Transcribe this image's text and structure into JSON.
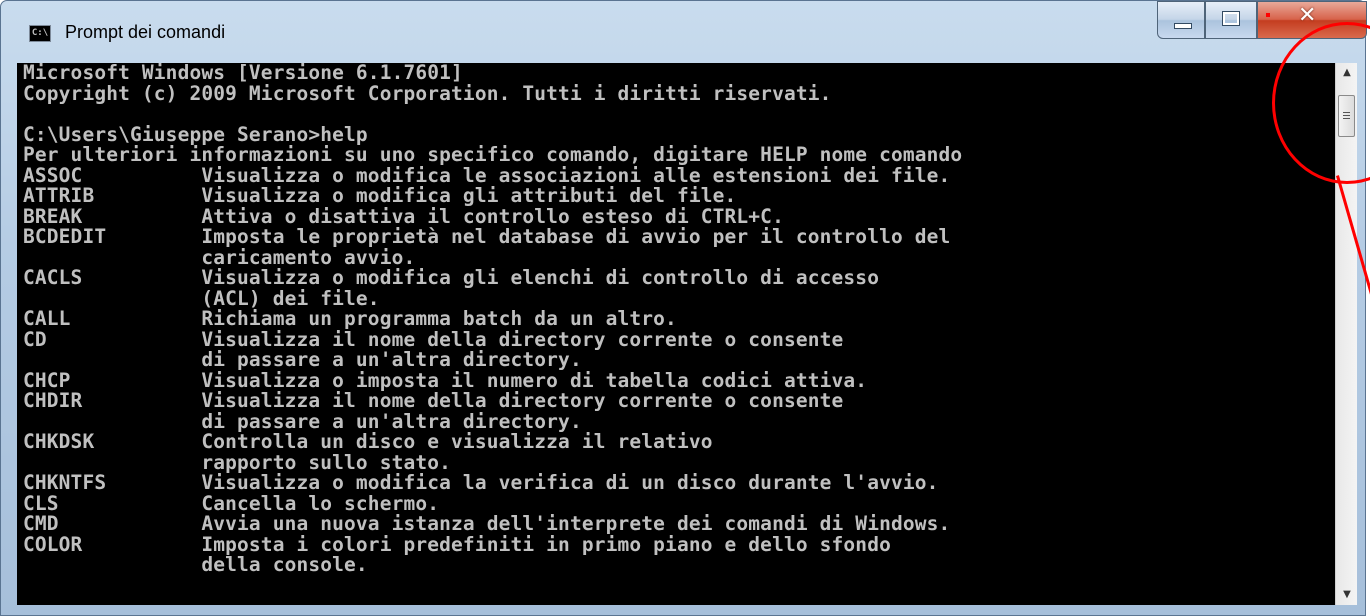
{
  "window": {
    "title": "Prompt dei comandi",
    "icon": "cmd-app-icon",
    "icon_text": "C:\\",
    "controls": {
      "minimize": "minimize-icon",
      "maximize": "maximize-icon",
      "close": "close-icon"
    }
  },
  "console": {
    "lines": [
      "Microsoft Windows [Versione 6.1.7601]",
      "Copyright (c) 2009 Microsoft Corporation. Tutti i diritti riservati.",
      "",
      "C:\\Users\\Giuseppe Serano>help",
      "Per ulteriori informazioni su uno specifico comando, digitare HELP nome comando",
      "ASSOC          Visualizza o modifica le associazioni alle estensioni dei file.",
      "ATTRIB         Visualizza o modifica gli attributi del file.",
      "BREAK          Attiva o disattiva il controllo esteso di CTRL+C.",
      "BCDEDIT        Imposta le proprietà nel database di avvio per il controllo del",
      "               caricamento avvio.",
      "CACLS          Visualizza o modifica gli elenchi di controllo di accesso",
      "               (ACL) dei file.",
      "CALL           Richiama un programma batch da un altro.",
      "CD             Visualizza il nome della directory corrente o consente",
      "               di passare a un'altra directory.",
      "CHCP           Visualizza o imposta il numero di tabella codici attiva.",
      "CHDIR          Visualizza il nome della directory corrente o consente",
      "               di passare a un'altra directory.",
      "CHKDSK         Controlla un disco e visualizza il relativo",
      "               rapporto sullo stato.",
      "CHKNTFS        Visualizza o modifica la verifica di un disco durante l'avvio.",
      "CLS            Cancella lo schermo.",
      "CMD            Avvia una nuova istanza dell'interprete dei comandi di Windows.",
      "COLOR          Imposta i colori predefiniti in primo piano e dello sfondo",
      "               della console."
    ],
    "text_color": "#c0c0c0",
    "background_color": "#000000"
  },
  "scrollbar": {
    "up_arrow": "▲",
    "down_arrow": "▼",
    "thumb_position_fraction": 0.02
  },
  "annotation": {
    "color": "#ff0000"
  }
}
